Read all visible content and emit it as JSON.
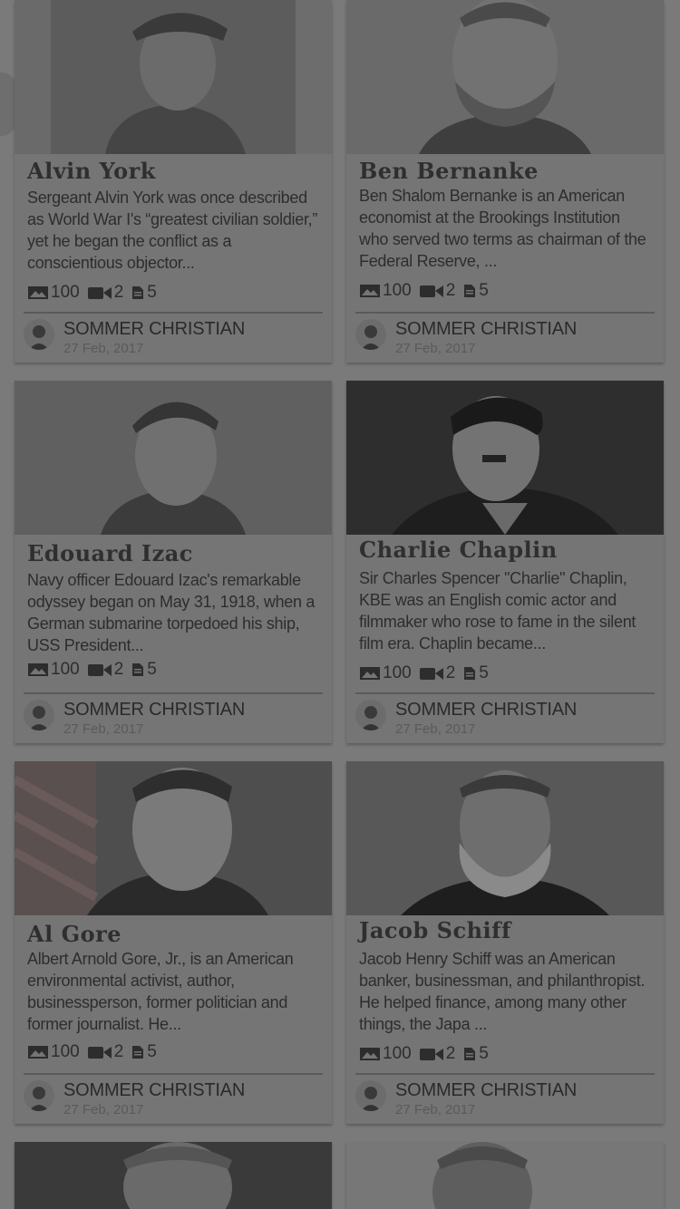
{
  "cards": [
    {
      "title": "Alvin York",
      "description": "Sergeant Alvin York was once described as World War I's “greatest civilian soldier,” yet he began the conflict as a conscientious objector...",
      "images": "100",
      "videos": "2",
      "docs": "5",
      "author": "SOMMER CHRISTIAN",
      "date": "27 Feb, 2017"
    },
    {
      "title": "Ben Bernanke",
      "description": "Ben Shalom Bernanke is an American economist at the Brookings Institution who served two terms as chairman of the Federal Reserve, ...",
      "images": "100",
      "videos": "2",
      "docs": "5",
      "author": "SOMMER CHRISTIAN",
      "date": "27 Feb, 2017"
    },
    {
      "title": "Edouard Izac",
      "description": "Navy officer Edouard Izac's remarkable odyssey began on May 31, 1918, when a German submarine torpedoed his ship, USS President...",
      "images": "100",
      "videos": "2",
      "docs": "5",
      "author": "SOMMER CHRISTIAN",
      "date": "27 Feb, 2017"
    },
    {
      "title": "Charlie Chaplin",
      "description": "Sir Charles Spencer \"Charlie\" Chaplin, KBE was an English comic actor and filmmaker who rose to fame in the silent film era. Chaplin became...",
      "images": "100",
      "videos": "2",
      "docs": "5",
      "author": "SOMMER CHRISTIAN",
      "date": "27 Feb, 2017"
    },
    {
      "title": "Al Gore",
      "description": "Albert Arnold Gore, Jr., is an American environmental activist, author, businessperson, former politician and former journalist. He...",
      "images": "100",
      "videos": "2",
      "docs": "5",
      "author": "SOMMER CHRISTIAN",
      "date": "27 Feb, 2017"
    },
    {
      "title": "Jacob Schiff",
      "description": "Jacob Henry Schiff was an American banker, businessman, and philanthropist. He helped finance, among many other things, the Japa ...",
      "images": "100",
      "videos": "2",
      "docs": "5",
      "author": "SOMMER CHRISTIAN",
      "date": "27 Feb, 2017"
    }
  ],
  "icons": {
    "images": "image-icon",
    "videos": "video-camera-icon",
    "docs": "document-icon"
  }
}
